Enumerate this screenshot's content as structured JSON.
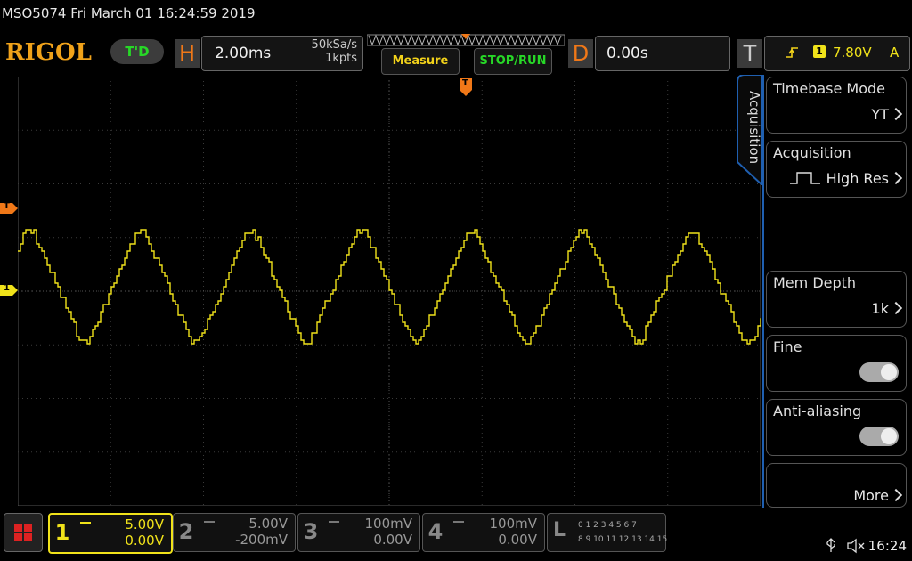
{
  "title_bar": {
    "device_title": "MSO5074  Fri March 01 16:24:59 2019"
  },
  "top_bar": {
    "logo": "RIGOL",
    "run_status": "T'D",
    "horizontal": {
      "letter": "H",
      "timebase": "2.00ms",
      "sample_rate": "50kSa/s",
      "memory": "1kpts"
    },
    "measure_label": "Measure",
    "stop_run_label": "STOP/RUN",
    "delay": {
      "letter": "D",
      "value": "0.00s"
    },
    "trigger": {
      "letter": "T",
      "level": "7.80V",
      "source": "1",
      "mode": "A"
    }
  },
  "waveform": {
    "markers": {
      "trigger_level": "T",
      "channel_1": "1",
      "trigger_position": "T"
    }
  },
  "side_menu": {
    "tab_label": "Acquisition",
    "items": [
      {
        "label": "Timebase Mode",
        "value": "YT"
      },
      {
        "label": "Acquisition",
        "value": "High Res"
      },
      {
        "label": "Mem Depth",
        "value": "1k"
      },
      {
        "label": "Fine",
        "toggle": "off"
      },
      {
        "label": "Anti-aliasing",
        "toggle": "off"
      },
      {
        "label": "More"
      }
    ]
  },
  "channels": [
    {
      "num": "1",
      "scale": "5.00V",
      "offset": "0.00V"
    },
    {
      "num": "2",
      "scale": "5.00V",
      "offset": "-200mV"
    },
    {
      "num": "3",
      "scale": "100mV",
      "offset": "0.00V"
    },
    {
      "num": "4",
      "scale": "100mV",
      "offset": "0.00V"
    }
  ],
  "logic_analyzer": {
    "letter": "L",
    "row1": "0 1 2 3  4 5 6 7",
    "row2": "8 9 10 11 12 13 14 15"
  },
  "status": {
    "time": "16:24"
  },
  "colors": {
    "accent": "#f0a21a",
    "channel1": "#f0e21a",
    "trigger": "#f07818",
    "run": "#27d827",
    "panel_blue": "#1f5fb0"
  }
}
